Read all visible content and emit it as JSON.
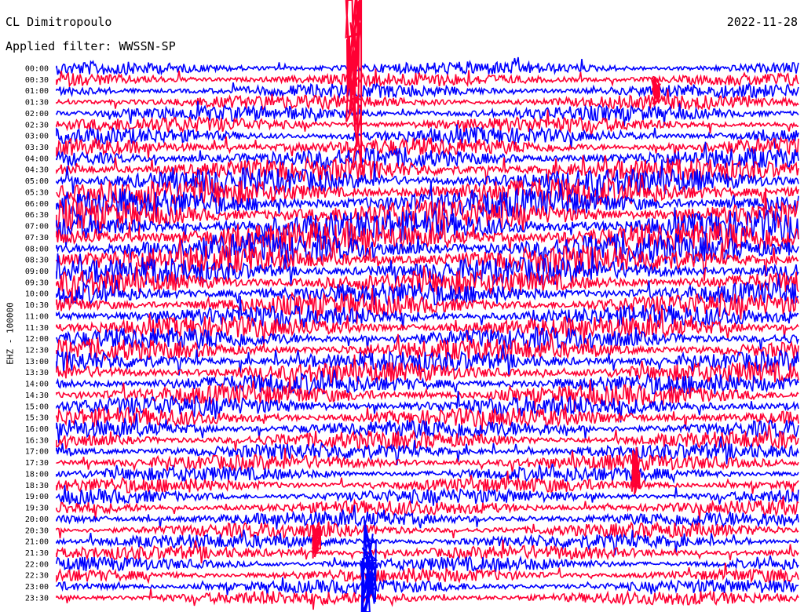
{
  "header": {
    "station": "CL Dimitropoulo",
    "date": "2022-11-28",
    "filter": "Applied filter: WWSSN-SP"
  },
  "axis": {
    "ylabel": "EHZ - 100000"
  },
  "colors": {
    "trace_a": "#0000ff",
    "trace_b": "#ff0033",
    "background": "#ffffff"
  },
  "chart_data": {
    "type": "line",
    "title": "CL Dimitropoulo",
    "ylabel": "EHZ - 100000",
    "row_labels": [
      "00:00",
      "00:30",
      "01:00",
      "01:30",
      "02:00",
      "02:30",
      "03:00",
      "03:30",
      "04:00",
      "04:30",
      "05:00",
      "05:30",
      "06:00",
      "06:30",
      "07:00",
      "07:30",
      "08:00",
      "08:30",
      "09:00",
      "09:30",
      "10:00",
      "10:30",
      "11:00",
      "11:30",
      "12:00",
      "12:30",
      "13:00",
      "13:30",
      "14:00",
      "14:30",
      "15:00",
      "15:30",
      "16:00",
      "16:30",
      "17:00",
      "17:30",
      "18:00",
      "18:30",
      "19:00",
      "19:30",
      "20:00",
      "20:30",
      "21:00",
      "21:30",
      "22:00",
      "22:30",
      "23:00",
      "23:30"
    ],
    "noise_level": [
      0.35,
      0.38,
      0.4,
      0.42,
      0.45,
      0.5,
      0.55,
      0.65,
      0.8,
      1.0,
      1.15,
      1.3,
      1.4,
      1.45,
      1.5,
      1.5,
      1.45,
      1.35,
      1.2,
      1.1,
      1.0,
      0.95,
      0.9,
      0.9,
      0.9,
      0.9,
      0.85,
      0.85,
      0.8,
      0.8,
      0.8,
      0.75,
      0.7,
      0.65,
      0.55,
      0.5,
      0.45,
      0.45,
      0.45,
      0.45,
      0.45,
      0.45,
      0.4,
      0.4,
      0.4,
      0.4,
      0.38,
      0.38
    ],
    "events": [
      {
        "row": 0,
        "minute": 12,
        "amplitude": 20
      },
      {
        "row": 45,
        "minute": 12.6,
        "amplitude": 12
      },
      {
        "row": 36,
        "minute": 23.4,
        "amplitude": 5
      },
      {
        "row": 42,
        "minute": 10.5,
        "amplitude": 4
      },
      {
        "row": 2,
        "minute": 24.2,
        "amplitude": 3
      }
    ]
  }
}
